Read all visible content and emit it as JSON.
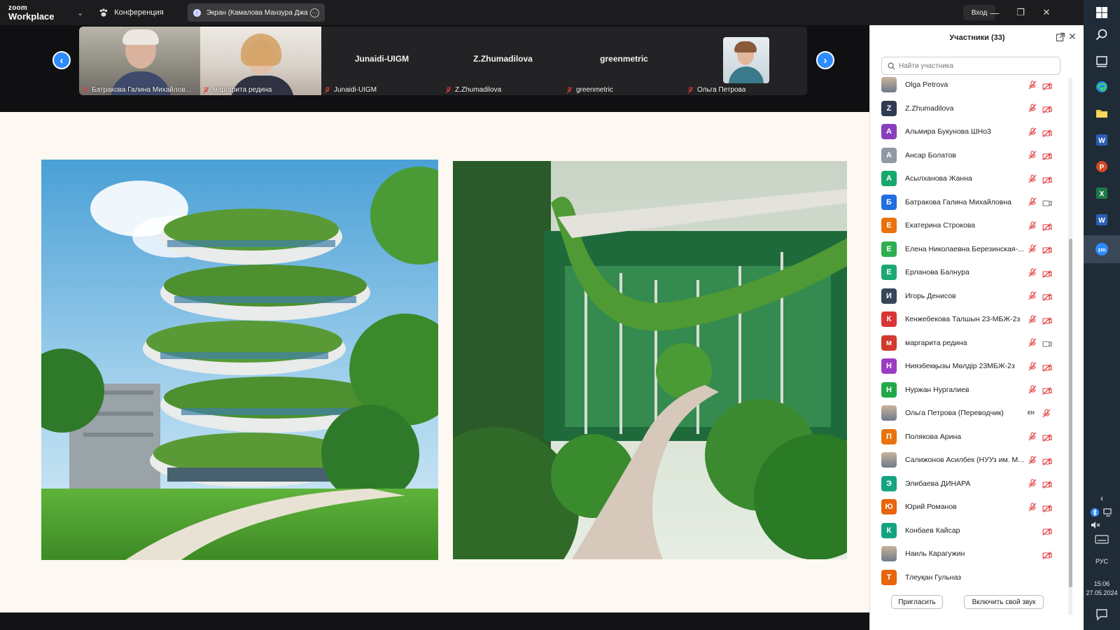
{
  "app": {
    "logo_top": "zoom",
    "logo_bottom": "Workplace",
    "conference_label": "Конференция",
    "share_label": "Экран (Камалова Манзура Джа",
    "login_label": "Вход"
  },
  "gallery": {
    "tiles": [
      {
        "label": "Батракова Галина Михайлов...",
        "name": "",
        "video": true
      },
      {
        "label": "маргарита редина",
        "name": "",
        "video": true
      },
      {
        "label": "Junaidi-UIGM",
        "name": "Junaidi-UIGM",
        "video": false
      },
      {
        "label": "Z.Zhumadilova",
        "name": "Z.Zhumadilova",
        "video": false
      },
      {
        "label": "greenmetric",
        "name": "greenmetric",
        "video": false
      },
      {
        "label": "Ольга Петрова",
        "name": "",
        "video": false
      }
    ]
  },
  "participants": {
    "title": "Участники (33)",
    "search_placeholder": "Найти участника",
    "invite_label": "Пригласить",
    "unmute_label": "Включить свой звук",
    "items": [
      {
        "name": "Olga Petrova",
        "initial": "",
        "color": "#8a8a8a",
        "mic": "muted",
        "cam": "off"
      },
      {
        "name": "Z.Zhumadilova",
        "initial": "Z",
        "color": "#2f3b52",
        "mic": "muted",
        "cam": "off"
      },
      {
        "name": "Альмира Букунова  ШНо3",
        "initial": "А",
        "color": "#8b3fbf",
        "mic": "muted",
        "cam": "off"
      },
      {
        "name": "Ансар Болатов",
        "initial": "А",
        "color": "#8f9aa3",
        "mic": "muted",
        "cam": "off"
      },
      {
        "name": "Асылханова Жанна",
        "initial": "А",
        "color": "#17a86b",
        "mic": "muted",
        "cam": "off"
      },
      {
        "name": "Батракова Галина Михайловна",
        "initial": "Б",
        "color": "#1f6fe0",
        "mic": "muted",
        "cam": "on"
      },
      {
        "name": "Екатерина Строкова",
        "initial": "Е",
        "color": "#e8720c",
        "mic": "muted",
        "cam": "off"
      },
      {
        "name": "Елена Николаевна Березинская-...",
        "initial": "Е",
        "color": "#2dae4f",
        "mic": "muted",
        "cam": "off"
      },
      {
        "name": "Ерланова Балнура",
        "initial": "Е",
        "color": "#1aa874",
        "mic": "muted",
        "cam": "off"
      },
      {
        "name": "Игорь Денисов",
        "initial": "И",
        "color": "#37465a",
        "mic": "muted",
        "cam": "off"
      },
      {
        "name": "Кенжебекова Талшын 23-МБЖ-2з",
        "initial": "К",
        "color": "#d93535",
        "mic": "muted",
        "cam": "off"
      },
      {
        "name": "маргарита редина",
        "initial": "м",
        "color": "#d23a2e",
        "mic": "muted",
        "cam": "on"
      },
      {
        "name": "Ниязбекқызы Мөлдір 23МБЖ-2з",
        "initial": "Н",
        "color": "#9a3cc2",
        "mic": "muted",
        "cam": "off"
      },
      {
        "name": "Нуржан Нургалиев",
        "initial": "Н",
        "color": "#22a84a",
        "mic": "muted",
        "cam": "off"
      },
      {
        "name": "Ольга Петрова (Переводчик)",
        "initial": "",
        "color": "#8a8a8a",
        "mic": "en",
        "cam": "mutedmic"
      },
      {
        "name": "Полякова Арина",
        "initial": "П",
        "color": "#e8720c",
        "mic": "muted",
        "cam": "off"
      },
      {
        "name": "Салижонов Асилбек (НУУз им. М...",
        "initial": "",
        "color": "#3d4a8a",
        "mic": "muted",
        "cam": "off"
      },
      {
        "name": "Элибаева ДИНАРА",
        "initial": "Э",
        "color": "#15a382",
        "mic": "muted",
        "cam": "off"
      },
      {
        "name": "Юрий Романов",
        "initial": "Ю",
        "color": "#e8650c",
        "mic": "muted",
        "cam": "off"
      },
      {
        "name": "Конбаев Кайсар",
        "initial": "К",
        "color": "#14a382",
        "mic": "none",
        "cam": "off"
      },
      {
        "name": "Наиль Карагужин",
        "initial": "",
        "color": "#e8eef5",
        "mic": "none",
        "cam": "off"
      },
      {
        "name": "Тлеуқан Гульназ",
        "initial": "Т",
        "color": "#e8650c",
        "mic": "none",
        "cam": "none"
      }
    ]
  },
  "taskbar": {
    "lang": "РУС",
    "time": "15:06",
    "date": "27.05.2024"
  }
}
